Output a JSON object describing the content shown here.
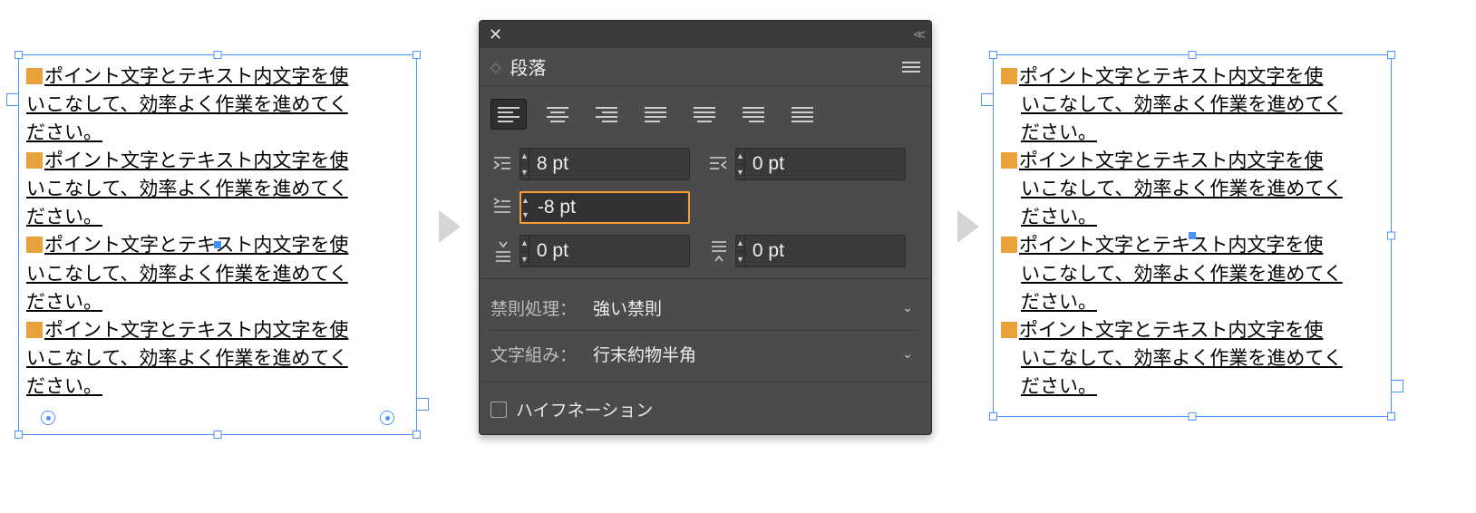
{
  "sample_text": {
    "line1_prefix": "",
    "line1": "ポイント文字とテキスト内文字を使",
    "line2": "いこなして、効率よく作業を進めてく",
    "line3": "ださい。"
  },
  "panel": {
    "title": "段落",
    "align_buttons": [
      "align-left",
      "align-center",
      "align-right",
      "justify-left",
      "justify-center",
      "justify-right",
      "justify-all"
    ],
    "indent_left": "8 pt",
    "indent_right": "0 pt",
    "indent_first_line": "-8 pt",
    "space_before": "0 pt",
    "space_after": "0 pt",
    "kinsoku_label": "禁則処理：",
    "kinsoku_value": "強い禁則",
    "mojikumi_label": "文字組み：",
    "mojikumi_value": "行末約物半角",
    "hyphenation_label": "ハイフネーション"
  }
}
